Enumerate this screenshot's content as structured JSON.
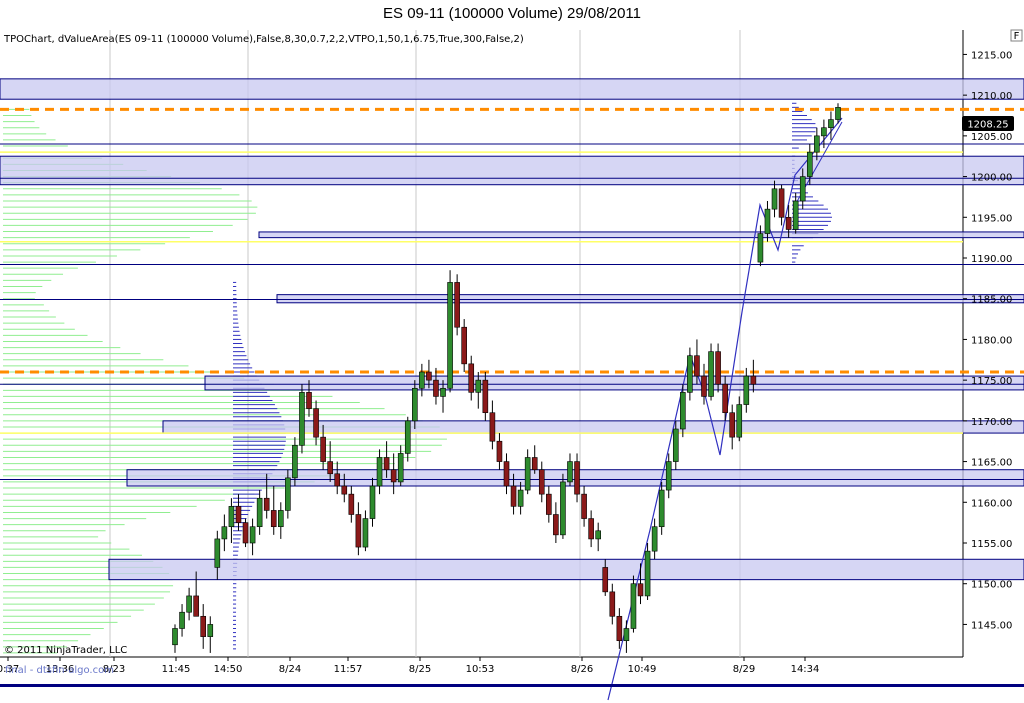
{
  "window": {
    "title": "ES 09-11 (100000 Volume)  29/08/2011"
  },
  "indicator_label": "TPOChart, dValueArea(ES 09-11 (100000 Volume),False,8,30,0.7,2,2,VTPO,1,50,1,6.75,True,300,False,2)",
  "panel_button": "F",
  "copyright": "© 2011 NinjaTrader, LLC",
  "overlay_text": "final - dtsfin-algo.com",
  "price_marker": "1208.25",
  "colors": {
    "candle_up": "#2e8b2e",
    "candle_down": "#8b1a1a",
    "value_area_line": "#000080",
    "value_area_fill": "#c8c8f0",
    "poc_dashed": "#ff8c00",
    "yellow_line": "#ffff66",
    "volume_profile": "#90ee90",
    "tpo_profile": "#3030c0"
  },
  "chart_data": {
    "type": "candlestick",
    "y_axis": {
      "min": 1141,
      "max": 1218,
      "ticks": [
        1145,
        1150,
        1155,
        1160,
        1165,
        1170,
        1175,
        1180,
        1185,
        1190,
        1195,
        1200,
        1205,
        1210,
        1215
      ],
      "tick_labels": [
        "1145.00",
        "1150.00",
        "1155.00",
        "1160.00",
        "1165.00",
        "1170.00",
        "1175.00",
        "1180.00",
        "1185.00",
        "1190.00",
        "1195.00",
        "1200.00",
        "1205.00",
        "1210.00",
        "1215.00"
      ]
    },
    "x_labels": [
      "0:37",
      "13:36",
      "8/23",
      "11:45",
      "14:50",
      "8/24",
      "11:57",
      "8/25",
      "10:53",
      "8/26",
      "10:49",
      "8/29",
      "14:34"
    ],
    "last_price": 1208.25,
    "value_area_bands": [
      {
        "low": 1209.5,
        "high": 1212.0
      },
      {
        "low": 1199.0,
        "high": 1202.5
      },
      {
        "low": 1192.5,
        "high": 1193.2
      },
      {
        "low": 1184.5,
        "high": 1185.5
      },
      {
        "low": 1173.8,
        "high": 1175.5
      },
      {
        "low": 1168.5,
        "high": 1170.0
      },
      {
        "low": 1162.0,
        "high": 1164.0
      },
      {
        "low": 1150.5,
        "high": 1153.0
      }
    ],
    "dashed_levels": [
      1208.25,
      1176.0
    ],
    "yellow_levels": [
      1203.0,
      1192.0,
      1168.5
    ],
    "candles": [
      {
        "o": 1142.5,
        "h": 1145.0,
        "l": 1141.5,
        "c": 1144.5
      },
      {
        "o": 1144.5,
        "h": 1147.5,
        "l": 1143.5,
        "c": 1146.5
      },
      {
        "o": 1146.5,
        "h": 1149.5,
        "l": 1145.5,
        "c": 1148.5
      },
      {
        "o": 1148.5,
        "h": 1151.5,
        "l": 1147.0,
        "c": 1146.0
      },
      {
        "o": 1146.0,
        "h": 1147.5,
        "l": 1142.0,
        "c": 1143.5
      },
      {
        "o": 1143.5,
        "h": 1146.0,
        "l": 1141.5,
        "c": 1145.0
      },
      {
        "o": 1152.0,
        "h": 1156.5,
        "l": 1150.5,
        "c": 1155.5
      },
      {
        "o": 1155.5,
        "h": 1158.5,
        "l": 1154.0,
        "c": 1157.0
      },
      {
        "o": 1157.0,
        "h": 1160.5,
        "l": 1155.0,
        "c": 1159.5
      },
      {
        "o": 1159.5,
        "h": 1161.0,
        "l": 1156.5,
        "c": 1157.5
      },
      {
        "o": 1157.5,
        "h": 1158.0,
        "l": 1154.5,
        "c": 1155.0
      },
      {
        "o": 1155.0,
        "h": 1158.0,
        "l": 1153.5,
        "c": 1157.0
      },
      {
        "o": 1157.0,
        "h": 1161.5,
        "l": 1156.0,
        "c": 1160.5
      },
      {
        "o": 1160.5,
        "h": 1163.5,
        "l": 1158.0,
        "c": 1159.0
      },
      {
        "o": 1159.0,
        "h": 1162.0,
        "l": 1156.0,
        "c": 1157.0
      },
      {
        "o": 1157.0,
        "h": 1160.0,
        "l": 1155.5,
        "c": 1159.0
      },
      {
        "o": 1159.0,
        "h": 1164.0,
        "l": 1158.0,
        "c": 1163.0
      },
      {
        "o": 1163.0,
        "h": 1168.0,
        "l": 1162.0,
        "c": 1167.0
      },
      {
        "o": 1167.0,
        "h": 1174.5,
        "l": 1166.0,
        "c": 1173.5
      },
      {
        "o": 1173.5,
        "h": 1175.0,
        "l": 1170.5,
        "c": 1171.5
      },
      {
        "o": 1171.5,
        "h": 1172.5,
        "l": 1167.0,
        "c": 1168.0
      },
      {
        "o": 1168.0,
        "h": 1169.5,
        "l": 1164.0,
        "c": 1165.0
      },
      {
        "o": 1165.0,
        "h": 1167.5,
        "l": 1162.5,
        "c": 1163.5
      },
      {
        "o": 1163.5,
        "h": 1165.0,
        "l": 1161.0,
        "c": 1162.0
      },
      {
        "o": 1162.0,
        "h": 1163.5,
        "l": 1160.0,
        "c": 1161.0
      },
      {
        "o": 1161.0,
        "h": 1162.0,
        "l": 1157.5,
        "c": 1158.5
      },
      {
        "o": 1158.5,
        "h": 1160.0,
        "l": 1153.5,
        "c": 1154.5
      },
      {
        "o": 1154.5,
        "h": 1159.0,
        "l": 1154.0,
        "c": 1158.0
      },
      {
        "o": 1158.0,
        "h": 1163.0,
        "l": 1157.0,
        "c": 1162.0
      },
      {
        "o": 1162.0,
        "h": 1166.5,
        "l": 1161.0,
        "c": 1165.5
      },
      {
        "o": 1165.5,
        "h": 1167.5,
        "l": 1163.0,
        "c": 1164.0
      },
      {
        "o": 1164.0,
        "h": 1166.0,
        "l": 1161.0,
        "c": 1162.5
      },
      {
        "o": 1162.5,
        "h": 1167.0,
        "l": 1162.0,
        "c": 1166.0
      },
      {
        "o": 1166.0,
        "h": 1170.5,
        "l": 1165.0,
        "c": 1170.0
      },
      {
        "o": 1170.0,
        "h": 1175.0,
        "l": 1169.0,
        "c": 1174.0
      },
      {
        "o": 1174.0,
        "h": 1177.0,
        "l": 1173.0,
        "c": 1176.0
      },
      {
        "o": 1176.0,
        "h": 1177.5,
        "l": 1174.0,
        "c": 1175.0
      },
      {
        "o": 1175.0,
        "h": 1176.5,
        "l": 1172.0,
        "c": 1173.0
      },
      {
        "o": 1173.0,
        "h": 1175.0,
        "l": 1171.0,
        "c": 1174.0
      },
      {
        "o": 1174.0,
        "h": 1188.5,
        "l": 1173.5,
        "c": 1187.0
      },
      {
        "o": 1187.0,
        "h": 1188.0,
        "l": 1180.5,
        "c": 1181.5
      },
      {
        "o": 1181.5,
        "h": 1182.5,
        "l": 1176.0,
        "c": 1177.0
      },
      {
        "o": 1177.0,
        "h": 1178.0,
        "l": 1172.5,
        "c": 1173.5
      },
      {
        "o": 1173.5,
        "h": 1176.0,
        "l": 1171.5,
        "c": 1175.0
      },
      {
        "o": 1175.0,
        "h": 1176.0,
        "l": 1170.0,
        "c": 1171.0
      },
      {
        "o": 1171.0,
        "h": 1172.5,
        "l": 1166.5,
        "c": 1167.5
      },
      {
        "o": 1167.5,
        "h": 1168.5,
        "l": 1164.0,
        "c": 1165.0
      },
      {
        "o": 1165.0,
        "h": 1166.0,
        "l": 1161.0,
        "c": 1162.0
      },
      {
        "o": 1162.0,
        "h": 1163.5,
        "l": 1158.5,
        "c": 1159.5
      },
      {
        "o": 1159.5,
        "h": 1162.5,
        "l": 1158.5,
        "c": 1161.5
      },
      {
        "o": 1161.5,
        "h": 1166.5,
        "l": 1161.0,
        "c": 1165.5
      },
      {
        "o": 1165.5,
        "h": 1167.0,
        "l": 1163.5,
        "c": 1164.0
      },
      {
        "o": 1164.0,
        "h": 1165.0,
        "l": 1160.0,
        "c": 1161.0
      },
      {
        "o": 1161.0,
        "h": 1162.0,
        "l": 1157.5,
        "c": 1158.5
      },
      {
        "o": 1158.5,
        "h": 1160.0,
        "l": 1155.0,
        "c": 1156.0
      },
      {
        "o": 1156.0,
        "h": 1163.5,
        "l": 1155.5,
        "c": 1162.5
      },
      {
        "o": 1162.5,
        "h": 1166.0,
        "l": 1162.0,
        "c": 1165.0
      },
      {
        "o": 1165.0,
        "h": 1166.0,
        "l": 1160.0,
        "c": 1161.0
      },
      {
        "o": 1161.0,
        "h": 1162.0,
        "l": 1157.0,
        "c": 1158.0
      },
      {
        "o": 1158.0,
        "h": 1159.0,
        "l": 1154.5,
        "c": 1155.5
      },
      {
        "o": 1155.5,
        "h": 1157.5,
        "l": 1154.0,
        "c": 1156.5
      },
      {
        "o": 1152.0,
        "h": 1153.0,
        "l": 1148.5,
        "c": 1149.0
      },
      {
        "o": 1149.0,
        "h": 1150.0,
        "l": 1145.0,
        "c": 1146.0
      },
      {
        "o": 1146.0,
        "h": 1147.0,
        "l": 1142.0,
        "c": 1143.0
      },
      {
        "o": 1143.0,
        "h": 1145.5,
        "l": 1141.5,
        "c": 1144.5
      },
      {
        "o": 1144.5,
        "h": 1151.0,
        "l": 1144.0,
        "c": 1150.0
      },
      {
        "o": 1150.0,
        "h": 1152.5,
        "l": 1147.5,
        "c": 1148.5
      },
      {
        "o": 1148.5,
        "h": 1155.0,
        "l": 1148.0,
        "c": 1154.0
      },
      {
        "o": 1154.0,
        "h": 1158.0,
        "l": 1153.0,
        "c": 1157.0
      },
      {
        "o": 1157.0,
        "h": 1162.5,
        "l": 1156.0,
        "c": 1161.5
      },
      {
        "o": 1161.5,
        "h": 1166.0,
        "l": 1160.5,
        "c": 1165.0
      },
      {
        "o": 1165.0,
        "h": 1170.0,
        "l": 1164.0,
        "c": 1169.0
      },
      {
        "o": 1169.0,
        "h": 1174.5,
        "l": 1168.0,
        "c": 1173.5
      },
      {
        "o": 1173.5,
        "h": 1179.0,
        "l": 1172.5,
        "c": 1178.0
      },
      {
        "o": 1178.0,
        "h": 1180.0,
        "l": 1174.5,
        "c": 1175.5
      },
      {
        "o": 1175.5,
        "h": 1177.0,
        "l": 1172.0,
        "c": 1173.0
      },
      {
        "o": 1173.0,
        "h": 1179.5,
        "l": 1172.5,
        "c": 1178.5
      },
      {
        "o": 1178.5,
        "h": 1179.5,
        "l": 1173.5,
        "c": 1174.5
      },
      {
        "o": 1174.5,
        "h": 1175.5,
        "l": 1170.0,
        "c": 1171.0
      },
      {
        "o": 1171.0,
        "h": 1172.0,
        "l": 1166.5,
        "c": 1168.0
      },
      {
        "o": 1168.0,
        "h": 1173.0,
        "l": 1167.5,
        "c": 1172.0
      },
      {
        "o": 1172.0,
        "h": 1176.5,
        "l": 1171.0,
        "c": 1175.5
      },
      {
        "o": 1175.5,
        "h": 1177.5,
        "l": 1173.5,
        "c": 1174.5
      },
      {
        "o": 1189.5,
        "h": 1194.0,
        "l": 1189.0,
        "c": 1193.0
      },
      {
        "o": 1193.0,
        "h": 1197.0,
        "l": 1192.0,
        "c": 1196.0
      },
      {
        "o": 1196.0,
        "h": 1199.5,
        "l": 1195.0,
        "c": 1198.5
      },
      {
        "o": 1198.5,
        "h": 1199.0,
        "l": 1194.0,
        "c": 1195.0
      },
      {
        "o": 1195.0,
        "h": 1196.5,
        "l": 1192.5,
        "c": 1193.5
      },
      {
        "o": 1193.5,
        "h": 1198.0,
        "l": 1193.0,
        "c": 1197.0
      },
      {
        "o": 1197.0,
        "h": 1201.0,
        "l": 1196.0,
        "c": 1200.0
      },
      {
        "o": 1200.0,
        "h": 1204.0,
        "l": 1199.0,
        "c": 1203.0
      },
      {
        "o": 1203.0,
        "h": 1206.0,
        "l": 1202.0,
        "c": 1205.0
      },
      {
        "o": 1205.0,
        "h": 1207.0,
        "l": 1203.5,
        "c": 1206.0
      },
      {
        "o": 1206.0,
        "h": 1208.0,
        "l": 1204.5,
        "c": 1207.0
      },
      {
        "o": 1207.0,
        "h": 1209.0,
        "l": 1206.5,
        "c": 1208.5
      }
    ]
  }
}
